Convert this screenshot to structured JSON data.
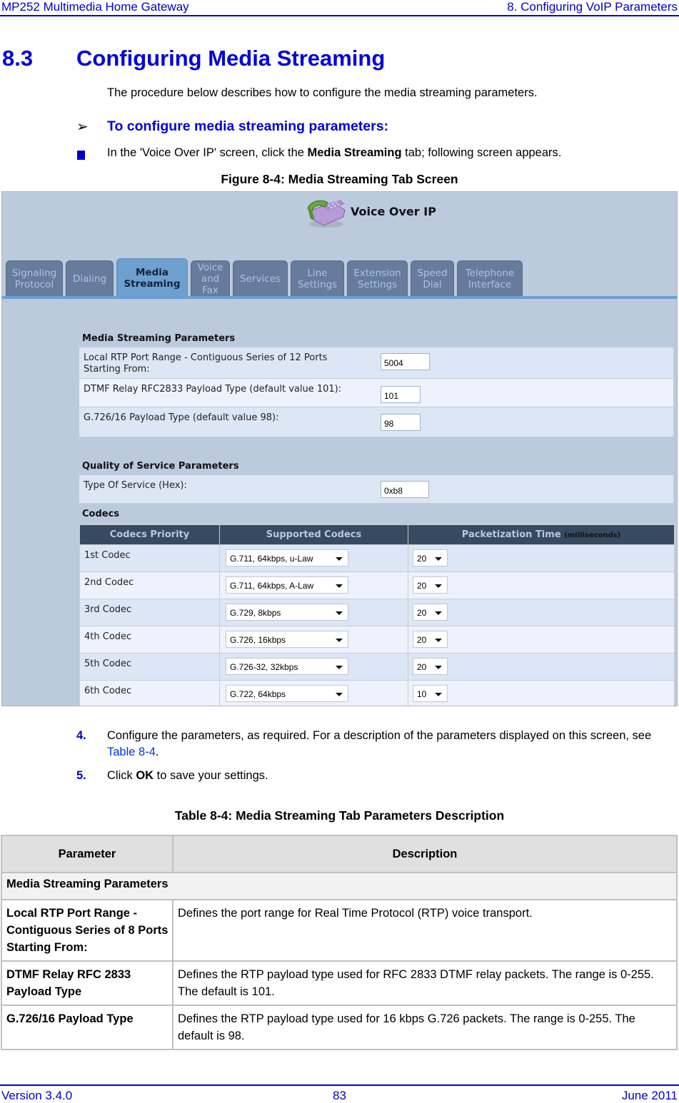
{
  "header": {
    "left": "MP252 Multimedia Home Gateway",
    "right": "8. Configuring VoIP Parameters"
  },
  "section": {
    "number": "8.3",
    "title": "Configuring Media Streaming",
    "intro": "The procedure below describes how to configure the media streaming parameters.",
    "procedure_title": "To configure media streaming parameters:",
    "bullet_prefix": "In the 'Voice Over IP' screen, click the ",
    "bullet_bold": "Media Streaming",
    "bullet_suffix": " tab; following screen appears."
  },
  "figure": {
    "caption": "Figure 8-4: Media Streaming Tab Screen",
    "screen_title": "Voice Over IP",
    "tabs": [
      {
        "line1": "Signaling",
        "line2": "Protocol",
        "line3": "",
        "active": false
      },
      {
        "line1": "Dialing",
        "line2": "",
        "line3": "",
        "active": false
      },
      {
        "line1": "Media",
        "line2": "Streaming",
        "line3": "",
        "active": true
      },
      {
        "line1": "Voice",
        "line2": "and",
        "line3": "Fax",
        "active": false
      },
      {
        "line1": "Services",
        "line2": "",
        "line3": "",
        "active": false
      },
      {
        "line1": "Line",
        "line2": "Settings",
        "line3": "",
        "active": false
      },
      {
        "line1": "Extension",
        "line2": "Settings",
        "line3": "",
        "active": false
      },
      {
        "line1": "Speed",
        "line2": "Dial",
        "line3": "",
        "active": false
      },
      {
        "line1": "Telephone",
        "line2": "Interface",
        "line3": "",
        "active": false
      }
    ],
    "media_streaming": {
      "heading": "Media Streaming Parameters",
      "rtp_label_1": "Local RTP Port Range - Contiguous Series of 12 Ports",
      "rtp_label_2": "Starting From:",
      "rtp_value": "5004",
      "dtmf_label": "DTMF Relay RFC2833 Payload Type (default value 101):",
      "dtmf_value": "101",
      "g726_label": "G.726/16 Payload Type (default value 98):",
      "g726_value": "98"
    },
    "qos": {
      "heading": "Quality of Service Parameters",
      "tos_label": "Type Of Service (Hex):",
      "tos_value": "0xb8"
    },
    "codecs": {
      "heading": "Codecs",
      "col_priority": "Codecs Priority",
      "col_supported": "Supported Codecs",
      "col_ptime": "Packetization Time",
      "col_ptime_unit": "(milliseconds)",
      "rows": [
        {
          "priority": "1st Codec",
          "codec": "G.711, 64kbps, u-Law",
          "ptime": "20"
        },
        {
          "priority": "2nd Codec",
          "codec": "G.711, 64kbps, A-Law",
          "ptime": "20"
        },
        {
          "priority": "3rd Codec",
          "codec": "G.729, 8kbps",
          "ptime": "20"
        },
        {
          "priority": "4th Codec",
          "codec": "G.726, 16kbps",
          "ptime": "20"
        },
        {
          "priority": "5th Codec",
          "codec": "G.726-32, 32kbps",
          "ptime": "20"
        },
        {
          "priority": "6th Codec",
          "codec": "G.722, 64kbps",
          "ptime": "10"
        }
      ]
    }
  },
  "steps": [
    {
      "num": "4.",
      "text_prefix": "Configure the parameters, as required. For a description of the parameters displayed on this screen, see ",
      "link": "Table 8-4",
      "text_suffix": "."
    },
    {
      "num": "5.",
      "text_prefix": "Click ",
      "bold": "OK",
      "text_suffix": " to save your settings."
    }
  ],
  "table": {
    "caption": "Table 8-4: Media Streaming Tab Parameters Description",
    "col_parameter": "Parameter",
    "col_description": "Description",
    "group": "Media Streaming Parameters",
    "rows": [
      {
        "parameter": "Local RTP Port Range - Contiguous Series of 8 Ports Starting From:",
        "description": "Defines the port range for Real Time Protocol (RTP) voice transport."
      },
      {
        "parameter": "DTMF Relay RFC 2833 Payload Type",
        "description": "Defines the RTP payload type used for RFC 2833 DTMF relay packets. The range is 0-255. The default is 101."
      },
      {
        "parameter": "G.726/16 Payload Type",
        "description": "Defines the RTP payload type used for 16 kbps G.726 packets. The range is 0-255. The default is 98."
      }
    ]
  },
  "footer": {
    "version": "Version 3.4.0",
    "page": "83",
    "date": "June 2011"
  }
}
